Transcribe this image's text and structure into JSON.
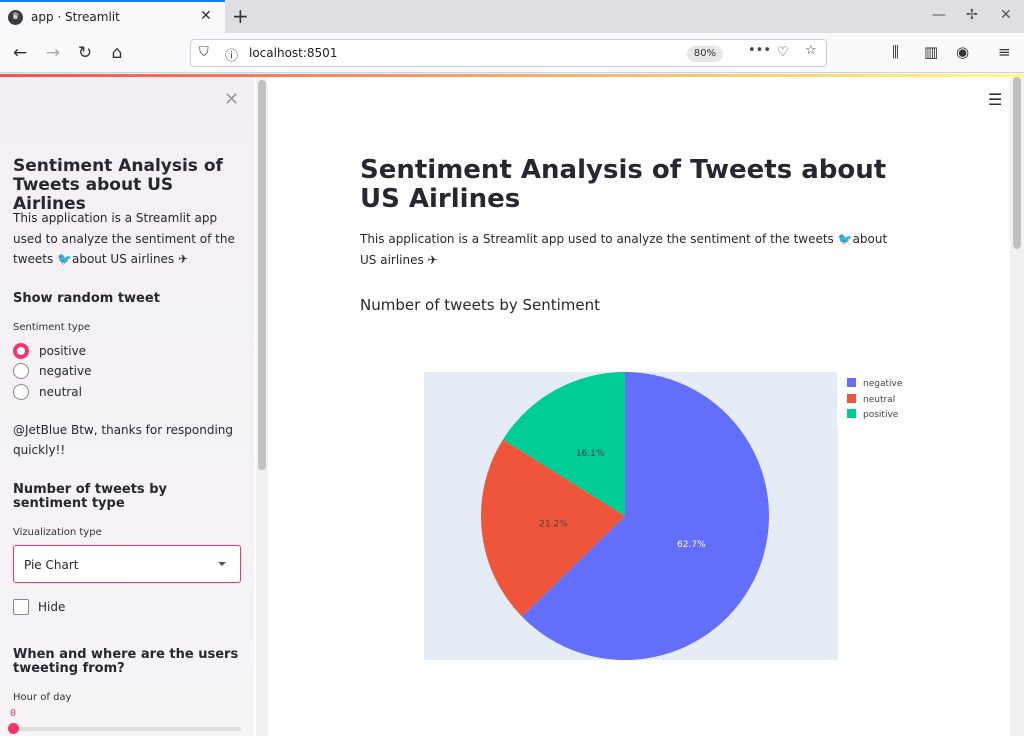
{
  "browser": {
    "tab_title": "app · Streamlit",
    "url": "localhost:8501",
    "zoom": "80%"
  },
  "sidebar": {
    "title": "Sentiment Analysis of Tweets about US Airlines",
    "description": "This application is a Streamlit app used to analyze the sentiment of the tweets 🐦about US airlines ✈",
    "random_tweet": {
      "heading": "Show random tweet",
      "label": "Sentiment type",
      "options": [
        "positive",
        "negative",
        "neutral"
      ],
      "selected": "positive",
      "tweet": "@JetBlue Btw, thanks for responding quickly!!"
    },
    "count": {
      "heading": "Number of tweets by sentiment type",
      "label": "Vizualization type",
      "select_value": "Pie Chart",
      "hide_label": "Hide"
    },
    "where": {
      "heading": "When and where are the users tweeting from?",
      "slider_label": "Hour of day",
      "slider_value": "0"
    }
  },
  "main": {
    "title": "Sentiment Analysis of Tweets about US Airlines",
    "description": "This application is a Streamlit app used to analyze the sentiment of the tweets 🐦about US airlines ✈",
    "subtitle": "Number of tweets by Sentiment"
  },
  "chart_data": {
    "type": "pie",
    "categories": [
      "negative",
      "neutral",
      "positive"
    ],
    "values": [
      62.7,
      21.2,
      16.1
    ],
    "labels": [
      "62.7%",
      "21.2%",
      "16.1%"
    ],
    "colors": [
      "#636efa",
      "#ef553b",
      "#00cc96"
    ],
    "legend": "top-right"
  }
}
